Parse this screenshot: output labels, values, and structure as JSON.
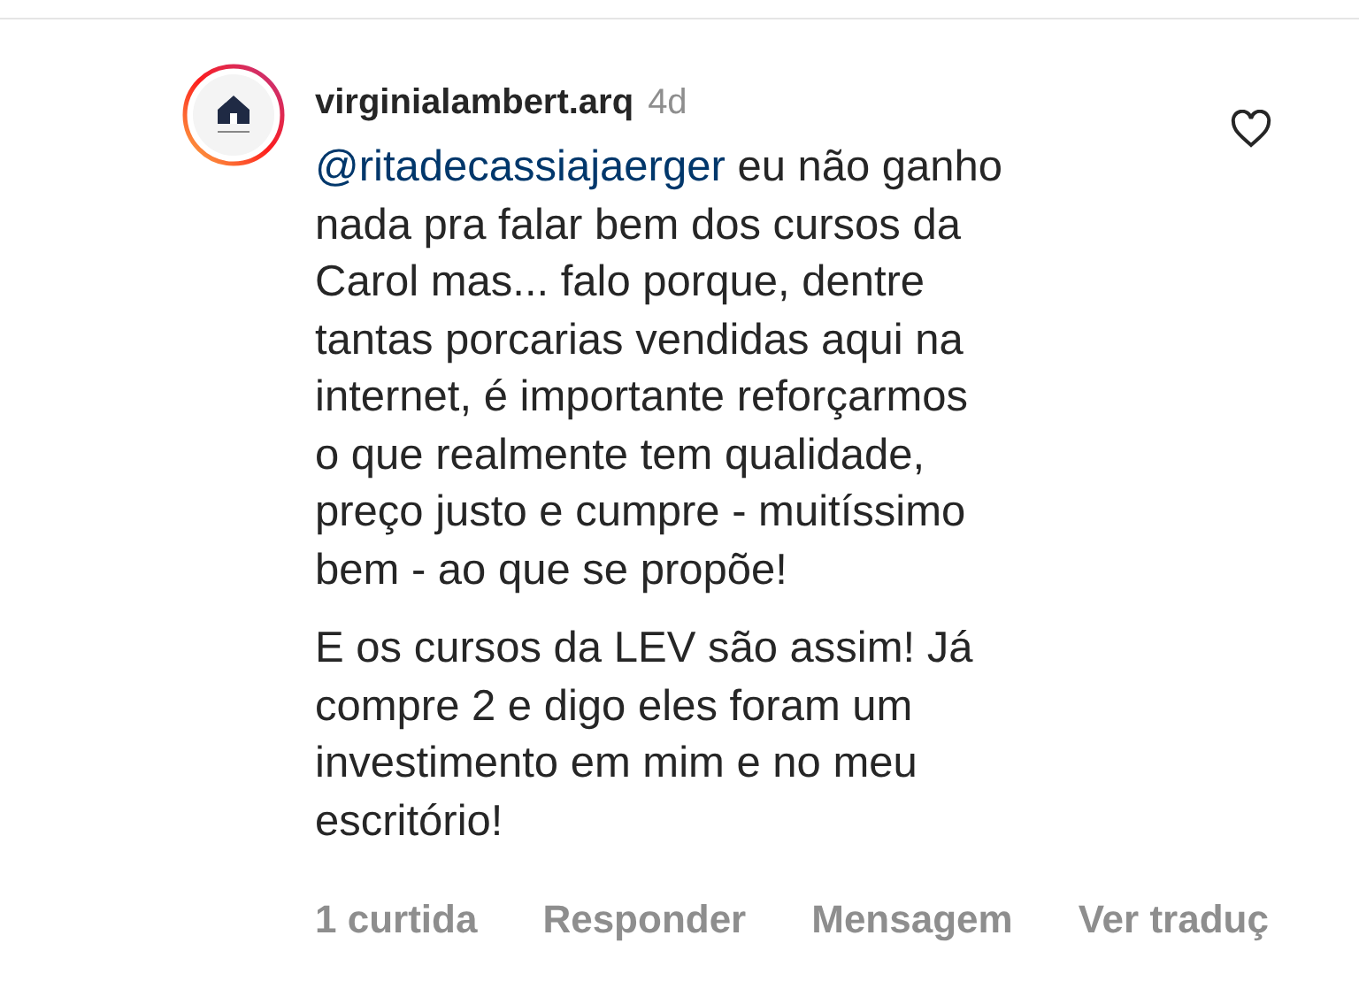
{
  "comment": {
    "username": "virginialambert.arq",
    "time": "4d",
    "liked": false,
    "paragraphs": [
      {
        "mention": "@ritadecassiajaerger",
        "lines": [
          "eu não ganho",
          "nada pra falar bem dos cursos da",
          "Carol mas... falo porque, dentre",
          "tantas porcarias vendidas aqui na",
          "internet, é importante reforçarmos",
          "o que realmente tem qualidade,",
          "preço justo e cumpre - muitíssimo",
          "bem - ao que se propõe!"
        ]
      },
      {
        "lines": [
          "E os cursos da LEV são assim! Já",
          "compre 2 e digo eles foram um",
          "investimento em mim e no meu",
          "escritório!"
        ]
      }
    ],
    "actions": [
      "1 curtida",
      "Responder",
      "Mensagem",
      "Ver traduç"
    ]
  }
}
